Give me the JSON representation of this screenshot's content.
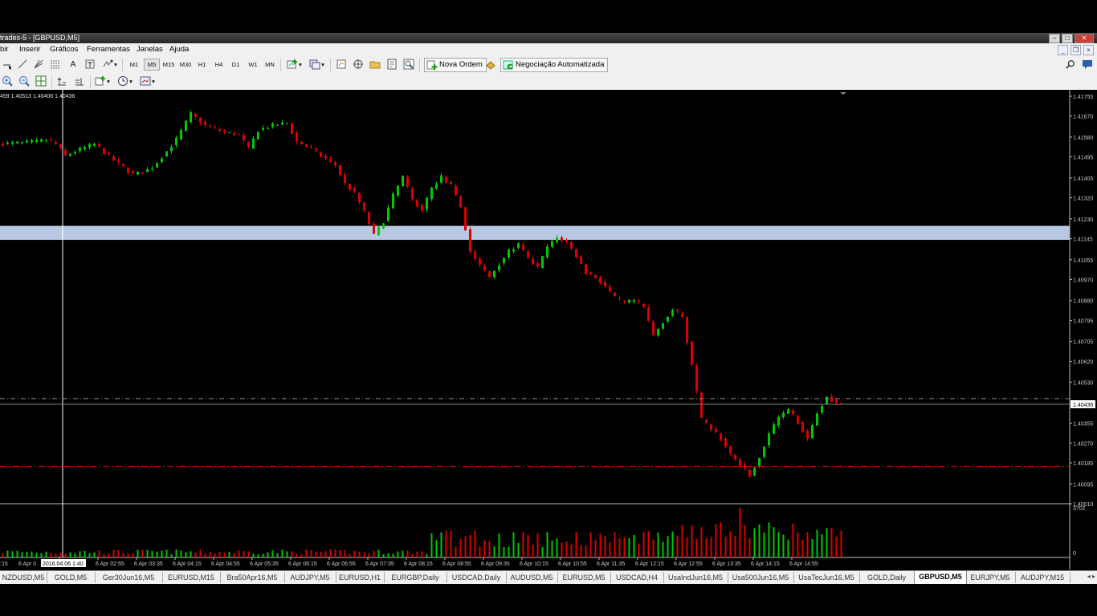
{
  "window": {
    "title": "trades-5 - [GBPUSD,M5]"
  },
  "menu": [
    "bir",
    "Inserir",
    "Gráficos",
    "Ferramentas",
    "Janelas",
    "Ajuda"
  ],
  "toolbar": {
    "timeframes": [
      "M1",
      "M5",
      "M15",
      "M30",
      "H1",
      "H4",
      "D1",
      "W1",
      "MN"
    ],
    "new_order_label": "Nova Ordem",
    "auto_trading_label": "Negociação Automatizada",
    "search_placeholder": ""
  },
  "chart": {
    "ohlc_label": "459 1.40513 1.40406 1.40436",
    "current_price": "1.40436",
    "volume_label": "3702",
    "volume_zero": "0",
    "crosshair_time": "2016.04.06 1:40",
    "colors": {
      "bull": "#00c800",
      "bear": "#dc0000",
      "zone": "#b8c8e2",
      "bid_line": "#808080",
      "level_line": "#e00000"
    }
  },
  "chart_data": {
    "type": "candlestick",
    "symbol": "GBPUSD",
    "timeframe": "M5",
    "price_ticks": [
      "1.41755",
      "1.41670",
      "1.41580",
      "1.41495",
      "1.41405",
      "1.41320",
      "1.41230",
      "1.41145",
      "1.41055",
      "1.40970",
      "1.40880",
      "1.40795",
      "1.40705",
      "1.40620",
      "1.40530",
      "1.40355",
      "1.40270",
      "1.40185",
      "1.40095",
      "1.40010"
    ],
    "time_ticks": [
      ":15",
      "6 Apr 0",
      "6 Apr 02:15",
      "6 Apr 02:55",
      "6 Apr 03:35",
      "6 Apr 04:15",
      "6 Apr 04:55",
      "6 Apr 05:35",
      "6 Apr 06:15",
      "6 Apr 06:55",
      "6 Apr 07:35",
      "6 Apr 08:15",
      "6 Apr 08:55",
      "6 Apr 09:35",
      "6 Apr 10:15",
      "6 Apr 10:55",
      "6 Apr 11:35",
      "6 Apr 12:15",
      "6 Apr 12:55",
      "6 Apr 13:35",
      "6 Apr 14:15",
      "6 Apr 14:55"
    ],
    "ylim": [
      1.4001,
      1.41755
    ],
    "zone": [
      1.4114,
      1.412
    ],
    "red_level": 1.4017,
    "bid_line": 1.40436,
    "ask_line": 1.4046,
    "path": [
      [
        0,
        1.4155
      ],
      [
        8,
        1.4156
      ],
      [
        10,
        1.4157
      ],
      [
        12,
        1.4155
      ],
      [
        14,
        1.415
      ],
      [
        16,
        1.4152
      ],
      [
        20,
        1.4155
      ],
      [
        24,
        1.4148
      ],
      [
        28,
        1.4142
      ],
      [
        30,
        1.4143
      ],
      [
        32,
        1.4145
      ],
      [
        35,
        1.4152
      ],
      [
        37,
        1.4157
      ],
      [
        40,
        1.4168
      ],
      [
        43,
        1.4163
      ],
      [
        47,
        1.416
      ],
      [
        50,
        1.4159
      ],
      [
        52,
        1.4153
      ],
      [
        54,
        1.4161
      ],
      [
        57,
        1.4163
      ],
      [
        60,
        1.4164
      ],
      [
        62,
        1.4156
      ],
      [
        65,
        1.4153
      ],
      [
        67,
        1.415
      ],
      [
        70,
        1.4146
      ],
      [
        72,
        1.4138
      ],
      [
        74,
        1.4134
      ],
      [
        76,
        1.4126
      ],
      [
        78,
        1.4116
      ],
      [
        80,
        1.4122
      ],
      [
        82,
        1.4133
      ],
      [
        84,
        1.4141
      ],
      [
        86,
        1.4131
      ],
      [
        88,
        1.4127
      ],
      [
        90,
        1.4136
      ],
      [
        92,
        1.4141
      ],
      [
        94,
        1.4137
      ],
      [
        96,
        1.4128
      ],
      [
        98,
        1.4109
      ],
      [
        100,
        1.4103
      ],
      [
        102,
        1.4098
      ],
      [
        104,
        1.4104
      ],
      [
        106,
        1.4109
      ],
      [
        108,
        1.4112
      ],
      [
        110,
        1.4106
      ],
      [
        112,
        1.4102
      ],
      [
        114,
        1.4111
      ],
      [
        116,
        1.4115
      ],
      [
        118,
        1.4113
      ],
      [
        120,
        1.4107
      ],
      [
        122,
        1.41
      ],
      [
        124,
        1.4098
      ],
      [
        126,
        1.4094
      ],
      [
        128,
        1.4089
      ],
      [
        130,
        1.4087
      ],
      [
        132,
        1.4088
      ],
      [
        134,
        1.4085
      ],
      [
        136,
        1.4073
      ],
      [
        138,
        1.4079
      ],
      [
        140,
        1.4084
      ],
      [
        142,
        1.4081
      ],
      [
        144,
        1.406
      ],
      [
        146,
        1.4037
      ],
      [
        148,
        1.4033
      ],
      [
        150,
        1.4029
      ],
      [
        152,
        1.4022
      ],
      [
        154,
        1.4018
      ],
      [
        156,
        1.4013
      ],
      [
        158,
        1.4021
      ],
      [
        160,
        1.4031
      ],
      [
        162,
        1.4038
      ],
      [
        164,
        1.4041
      ],
      [
        166,
        1.4036
      ],
      [
        168,
        1.4029
      ],
      [
        170,
        1.404
      ],
      [
        172,
        1.4047
      ],
      [
        174,
        1.4044
      ]
    ],
    "volume_range": [
      0,
      3702
    ]
  },
  "tabs": [
    {
      "label": "NZDUSD,M5"
    },
    {
      "label": "GOLD,M5"
    },
    {
      "label": "Ger30Jun16,M5"
    },
    {
      "label": "EURUSD,M15"
    },
    {
      "label": "Bra50Apr16,M5"
    },
    {
      "label": "AUDJPY,M5"
    },
    {
      "label": "EURUSD,H1"
    },
    {
      "label": "EURGBP,Daily"
    },
    {
      "label": "USDCAD,Daily"
    },
    {
      "label": "AUDUSD,M5"
    },
    {
      "label": "EURUSD,M5"
    },
    {
      "label": "USDCAD,H4"
    },
    {
      "label": "UsaIndJun16,M5"
    },
    {
      "label": "Usa500Jun16,M5"
    },
    {
      "label": "UsaTecJun16,M5"
    },
    {
      "label": "GOLD,Daily"
    },
    {
      "label": "GBPUSD,M5",
      "active": true
    },
    {
      "label": "EURJPY,M5"
    },
    {
      "label": "AUDJPY,M15"
    }
  ]
}
